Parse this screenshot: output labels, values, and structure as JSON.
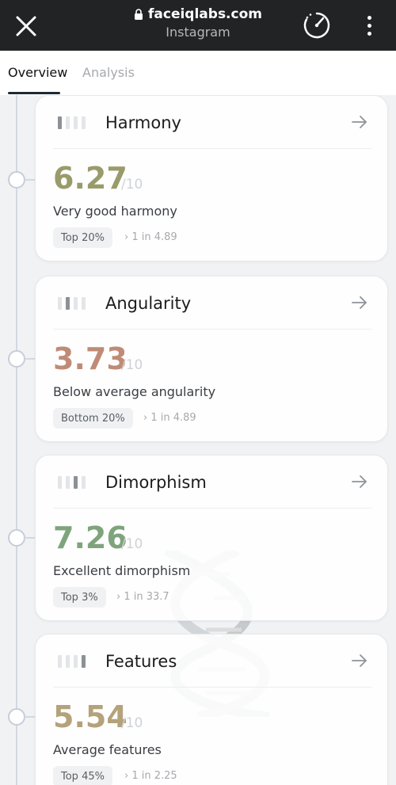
{
  "browser": {
    "url": "faceiqlabs.com",
    "subtitle": "Instagram"
  },
  "tabs": [
    {
      "label": "Overview",
      "active": true
    },
    {
      "label": "Analysis",
      "active": false
    }
  ],
  "cards": [
    {
      "title": "Harmony",
      "score": "6.27",
      "denominator": "/10",
      "description": "Very good harmony",
      "rank": "Top 20%",
      "ratio": "› 1 in 4.89",
      "score_color": "#9a9b6b",
      "active_bar": 1
    },
    {
      "title": "Angularity",
      "score": "3.73",
      "denominator": "/10",
      "description": "Below average angularity",
      "rank": "Bottom 20%",
      "ratio": "› 1 in 4.89",
      "score_color": "#c08b76",
      "active_bar": 2
    },
    {
      "title": "Dimorphism",
      "score": "7.26",
      "denominator": "/10",
      "description": "Excellent dimorphism",
      "rank": "Top 3%",
      "ratio": "› 1 in 33.7",
      "score_color": "#7fa47c",
      "active_bar": 3
    },
    {
      "title": "Features",
      "score": "5.54",
      "denominator": "/10",
      "description": "Average features",
      "rank": "Top 45%",
      "ratio": "› 1 in 2.25",
      "score_color": "#b4a27a",
      "active_bar": 4
    }
  ],
  "icons": {
    "close": "close-icon",
    "lock": "lock-icon",
    "speed": "speedometer-icon",
    "more": "more-vertical-icon",
    "arrow": "arrow-right-icon"
  }
}
